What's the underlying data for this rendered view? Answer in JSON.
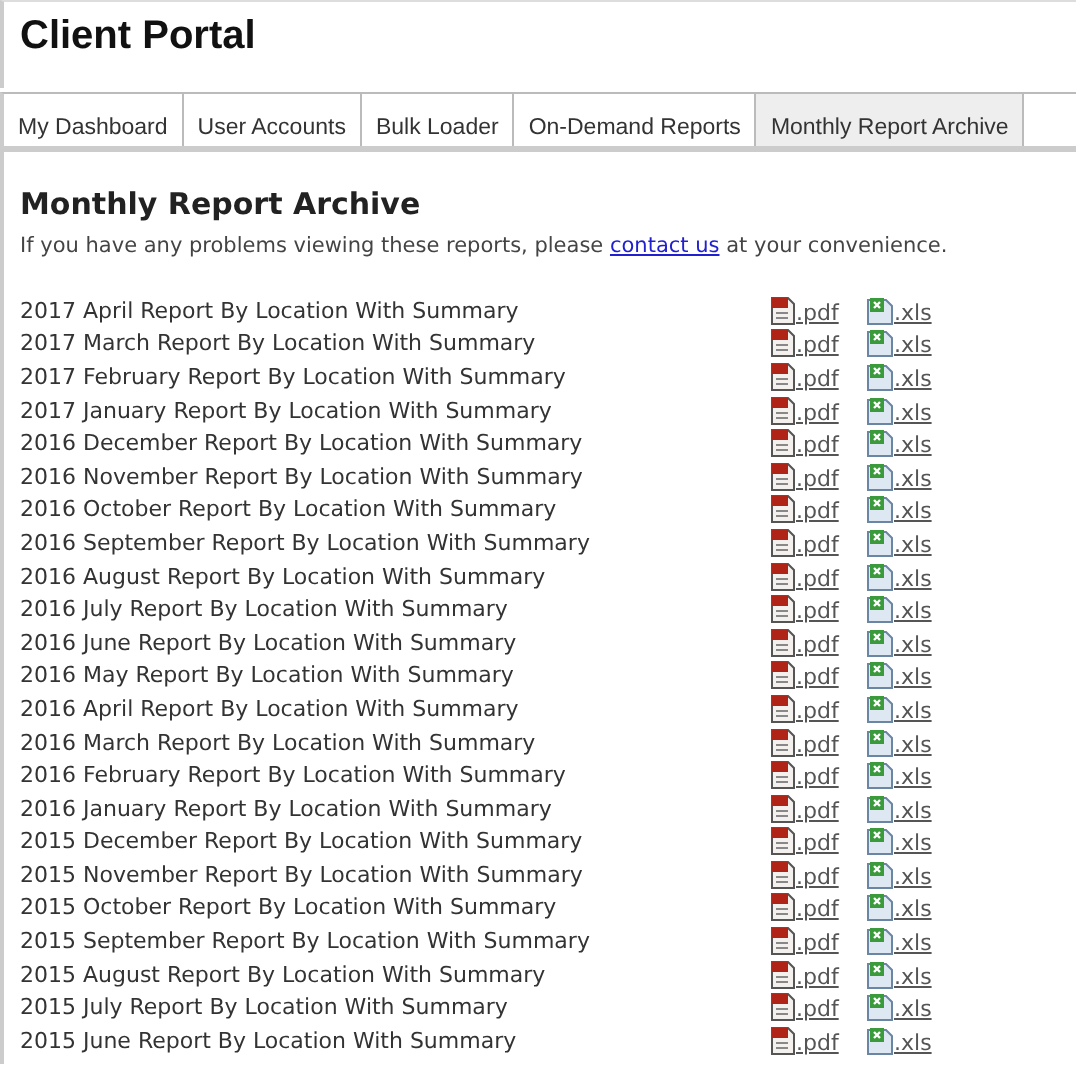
{
  "header": {
    "title": "Client Portal"
  },
  "tabs": [
    {
      "label": "My Dashboard",
      "selected": false
    },
    {
      "label": "User Accounts",
      "selected": false
    },
    {
      "label": "Bulk Loader",
      "selected": false
    },
    {
      "label": "On-Demand Reports",
      "selected": false
    },
    {
      "label": "Monthly Report Archive",
      "selected": true
    }
  ],
  "content": {
    "heading": "Monthly Report Archive",
    "notice": {
      "before": "If you have any problems viewing these reports, please",
      "link": "contact us",
      "after": "at your convenience."
    },
    "reports": [
      {
        "title": "2017 April Report By Location With Summary",
        "files": [
          {
            "kind": "pdf",
            "label": ".pdf"
          },
          {
            "kind": "xls",
            "label": ".xls"
          }
        ]
      },
      {
        "title": "2017 March Report By Location With Summary",
        "files": [
          {
            "kind": "pdf",
            "label": ".pdf"
          },
          {
            "kind": "xls",
            "label": ".xls"
          }
        ]
      },
      {
        "title": "2017 February Report By Location With Summary",
        "files": [
          {
            "kind": "pdf",
            "label": ".pdf"
          },
          {
            "kind": "xls",
            "label": ".xls"
          }
        ]
      },
      {
        "title": "2017 January Report By Location With Summary",
        "files": [
          {
            "kind": "pdf",
            "label": ".pdf"
          },
          {
            "kind": "xls",
            "label": ".xls"
          }
        ]
      },
      {
        "title": "2016 December Report By Location With Summary",
        "files": [
          {
            "kind": "pdf",
            "label": ".pdf"
          },
          {
            "kind": "xls",
            "label": ".xls"
          }
        ]
      },
      {
        "title": "2016 November Report By Location With Summary",
        "files": [
          {
            "kind": "pdf",
            "label": ".pdf"
          },
          {
            "kind": "xls",
            "label": ".xls"
          }
        ]
      },
      {
        "title": "2016 October Report By Location With Summary",
        "files": [
          {
            "kind": "pdf",
            "label": ".pdf"
          },
          {
            "kind": "xls",
            "label": ".xls"
          }
        ]
      },
      {
        "title": "2016 September Report By Location With Summary",
        "files": [
          {
            "kind": "pdf",
            "label": ".pdf"
          },
          {
            "kind": "xls",
            "label": ".xls"
          }
        ]
      },
      {
        "title": "2016 August Report By Location With Summary",
        "files": [
          {
            "kind": "pdf",
            "label": ".pdf"
          },
          {
            "kind": "xls",
            "label": ".xls"
          }
        ]
      },
      {
        "title": "2016 July Report By Location With Summary",
        "files": [
          {
            "kind": "pdf",
            "label": ".pdf"
          },
          {
            "kind": "xls",
            "label": ".xls"
          }
        ]
      },
      {
        "title": "2016 June Report By Location With Summary",
        "files": [
          {
            "kind": "pdf",
            "label": ".pdf"
          },
          {
            "kind": "xls",
            "label": ".xls"
          }
        ]
      },
      {
        "title": "2016 May Report By Location With Summary",
        "files": [
          {
            "kind": "pdf",
            "label": ".pdf"
          },
          {
            "kind": "xls",
            "label": ".xls"
          }
        ]
      },
      {
        "title": "2016 April Report By Location With Summary",
        "files": [
          {
            "kind": "pdf",
            "label": ".pdf"
          },
          {
            "kind": "xls",
            "label": ".xls"
          }
        ]
      },
      {
        "title": "2016 March Report By Location With Summary",
        "files": [
          {
            "kind": "pdf",
            "label": ".pdf"
          },
          {
            "kind": "xls",
            "label": ".xls"
          }
        ]
      },
      {
        "title": "2016 February Report By Location With Summary",
        "files": [
          {
            "kind": "pdf",
            "label": ".pdf"
          },
          {
            "kind": "xls",
            "label": ".xls"
          }
        ]
      },
      {
        "title": "2016 January Report By Location With Summary",
        "files": [
          {
            "kind": "pdf",
            "label": ".pdf"
          },
          {
            "kind": "xls",
            "label": ".xls"
          }
        ]
      },
      {
        "title": "2015 December Report By Location With Summary",
        "files": [
          {
            "kind": "pdf",
            "label": ".pdf"
          },
          {
            "kind": "xls",
            "label": ".xls"
          }
        ]
      },
      {
        "title": "2015 November Report By Location With Summary",
        "files": [
          {
            "kind": "pdf",
            "label": ".pdf"
          },
          {
            "kind": "xls",
            "label": ".xls"
          }
        ]
      },
      {
        "title": "2015 October Report By Location With Summary",
        "files": [
          {
            "kind": "pdf",
            "label": ".pdf"
          },
          {
            "kind": "xls",
            "label": ".xls"
          }
        ]
      },
      {
        "title": "2015 September Report By Location With Summary",
        "files": [
          {
            "kind": "pdf",
            "label": ".pdf"
          },
          {
            "kind": "xls",
            "label": ".xls"
          }
        ]
      },
      {
        "title": "2015 August Report By Location With Summary",
        "files": [
          {
            "kind": "pdf",
            "label": ".pdf"
          },
          {
            "kind": "xls",
            "label": ".xls"
          }
        ]
      },
      {
        "title": "2015 July Report By Location With Summary",
        "files": [
          {
            "kind": "pdf",
            "label": ".pdf"
          },
          {
            "kind": "xls",
            "label": ".xls"
          }
        ]
      },
      {
        "title": "2015 June Report By Location With Summary",
        "files": [
          {
            "kind": "pdf",
            "label": ".pdf"
          },
          {
            "kind": "xls",
            "label": ".xls"
          }
        ]
      }
    ]
  }
}
